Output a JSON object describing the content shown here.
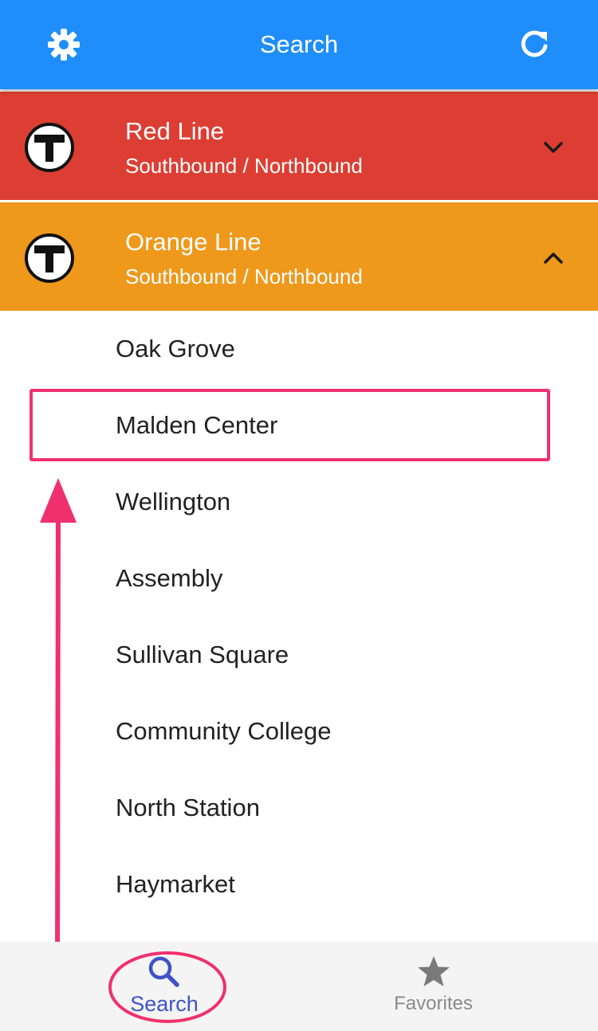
{
  "header": {
    "title": "Search",
    "settings_icon": "gear-icon",
    "refresh_icon": "refresh-icon",
    "color": "#1f8efa"
  },
  "lines": [
    {
      "name": "Red Line",
      "directions": "Southbound / Northbound",
      "color": "#dd3e33",
      "expanded": false,
      "icon": "mbta-t-logo",
      "chevron": "chevron-down-icon"
    },
    {
      "name": "Orange Line",
      "directions": "Southbound / Northbound",
      "color": "#ee981c",
      "expanded": true,
      "icon": "mbta-t-logo",
      "chevron": "chevron-up-icon"
    }
  ],
  "stations": [
    "Oak Grove",
    "Malden Center",
    "Wellington",
    "Assembly",
    "Sullivan Square",
    "Community College",
    "North Station",
    "Haymarket"
  ],
  "annotation": {
    "highlighted_station": "Malden Center",
    "color": "#f0306e"
  },
  "tabbar": {
    "tabs": [
      {
        "label": "Search",
        "icon": "search-icon",
        "active": true,
        "color": "#3e53c8"
      },
      {
        "label": "Favorites",
        "icon": "star-icon",
        "active": false,
        "color": "#8a8a8a"
      }
    ]
  }
}
